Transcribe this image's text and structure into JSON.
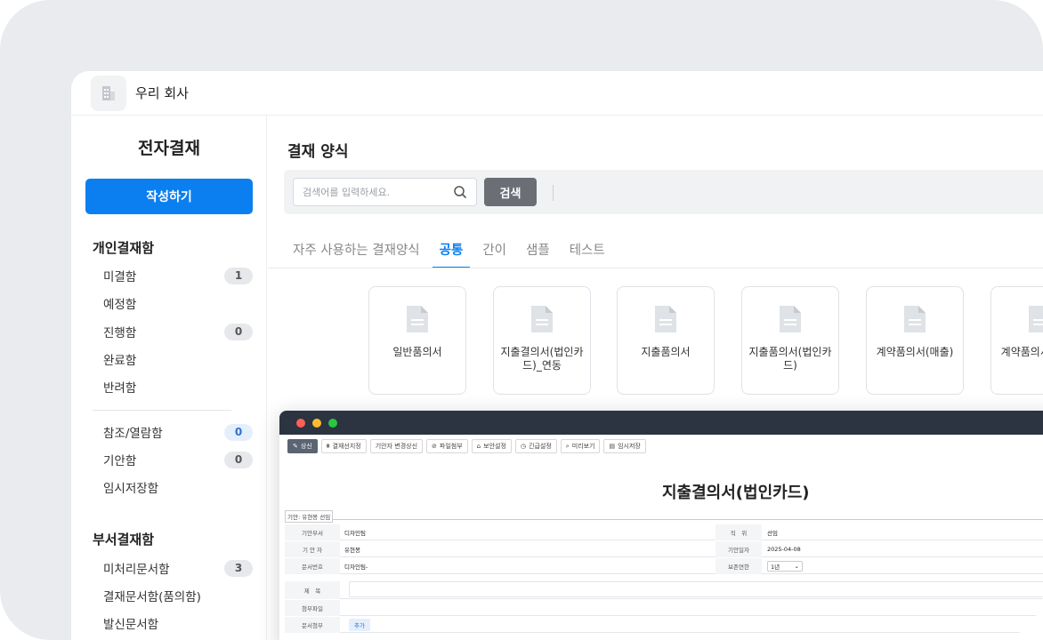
{
  "app": {
    "company_name": "우리 회사",
    "logo_icon": "building-icon"
  },
  "sidebar": {
    "title": "전자결재",
    "compose_label": "작성하기",
    "personal": {
      "title": "개인결재함",
      "items": [
        {
          "label": "미결함",
          "count": "1"
        },
        {
          "label": "예정함",
          "count": null
        },
        {
          "label": "진행함",
          "count": "0"
        },
        {
          "label": "완료함",
          "count": null
        },
        {
          "label": "반려함",
          "count": null
        }
      ]
    },
    "reference": {
      "items": [
        {
          "label": "참조/열람함",
          "count": "0"
        },
        {
          "label": "기안함",
          "count": "0"
        },
        {
          "label": "임시저장함",
          "count": null
        }
      ]
    },
    "department": {
      "title": "부서결재함",
      "items": [
        {
          "label": "미처리문서함",
          "count": "3"
        },
        {
          "label": "결재문서함(품의함)",
          "count": null
        },
        {
          "label": "발신문서함",
          "count": null
        }
      ]
    }
  },
  "main": {
    "title": "결재 양식",
    "search": {
      "placeholder": "검색어를 입력하세요.",
      "value": "",
      "button_label": "검색"
    },
    "tabs": [
      {
        "label": "자주 사용하는 결재양식",
        "active": false
      },
      {
        "label": "공통",
        "active": true
      },
      {
        "label": "간이",
        "active": false
      },
      {
        "label": "샘플",
        "active": false
      },
      {
        "label": "테스트",
        "active": false
      }
    ],
    "forms": [
      {
        "label": "일반품의서"
      },
      {
        "label": "지출결의서(법인카드)_연동"
      },
      {
        "label": "지출품의서"
      },
      {
        "label": "지출품의서(법인카드)"
      },
      {
        "label": "계약품의서(매출)"
      },
      {
        "label": "계약품의서(매입)"
      }
    ]
  },
  "preview": {
    "toolbar": [
      {
        "label": "상신",
        "icon": "pencil-icon",
        "primary": true
      },
      {
        "label": "결재선지정",
        "icon": "org-chart-icon",
        "primary": false
      },
      {
        "label": "기안자 변경상신",
        "icon": null,
        "primary": false
      },
      {
        "label": "파일첨부",
        "icon": "paperclip-icon",
        "primary": false
      },
      {
        "label": "보안설정",
        "icon": "lock-icon",
        "primary": false
      },
      {
        "label": "긴급설정",
        "icon": "clock-icon",
        "primary": false
      },
      {
        "label": "미리보기",
        "icon": "search-icon",
        "primary": false
      },
      {
        "label": "임시저장",
        "icon": "save-icon",
        "primary": false
      }
    ],
    "doc_title": "지출결의서(법인카드)",
    "drafter_tag": "기안: 유현봉 선임",
    "rows": {
      "dept_label": "기안부서",
      "dept_value": "디자인팀",
      "position_label": "직　위",
      "position_value": "선임",
      "drafter_label": "기 안 자",
      "drafter_value": "유현봉",
      "date_label": "기안일자",
      "date_value": "2025-04-08",
      "docno_label": "문서번호",
      "docno_value": "디자인팀-",
      "retention_label": "보존연한",
      "retention_value": "1년",
      "subject_label": "제　목",
      "attach_label": "첨부파일",
      "docattach_label": "문서첨부",
      "add_label": "추가"
    },
    "colors": {
      "close": "#ff5f57",
      "minimize": "#febc2e",
      "maximize": "#28c840",
      "bar": "#2b3440"
    }
  }
}
